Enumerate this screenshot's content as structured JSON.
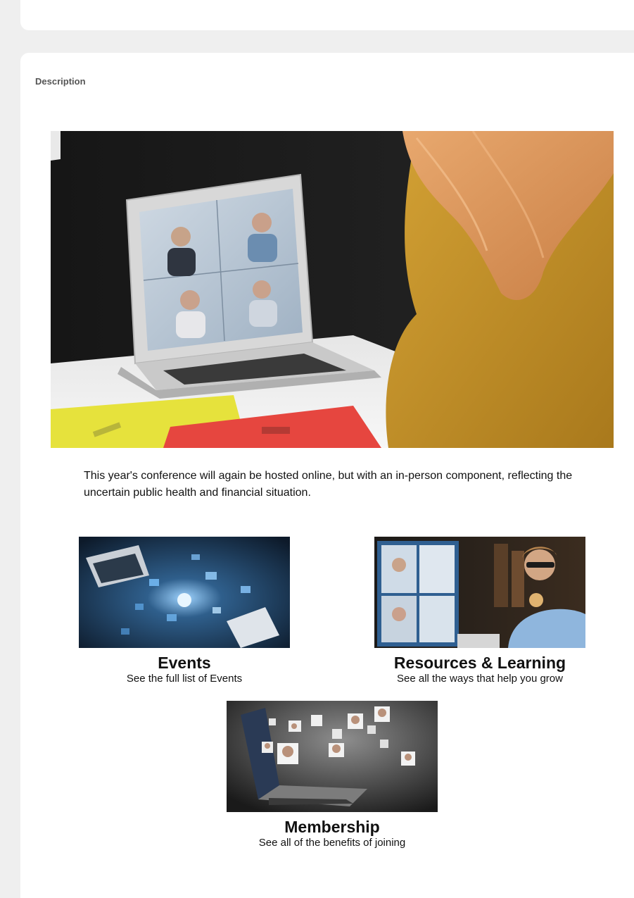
{
  "description": {
    "label": "Description",
    "intro_text": "This year's conference will again be hosted online, but with an in-person component, reflecting the uncertain public health and financial situation."
  },
  "tiles": [
    {
      "title": "Events",
      "subtitle": "See the full list of  Events"
    },
    {
      "title": "Resources & Learning",
      "subtitle": "See all the ways that  help you grow"
    },
    {
      "title": "Membership",
      "subtitle": "See all of the benefits of joining"
    }
  ],
  "colors": {
    "page_bg": "#efefef",
    "card_bg": "#ffffff",
    "label": "#555555",
    "text": "#111111"
  }
}
